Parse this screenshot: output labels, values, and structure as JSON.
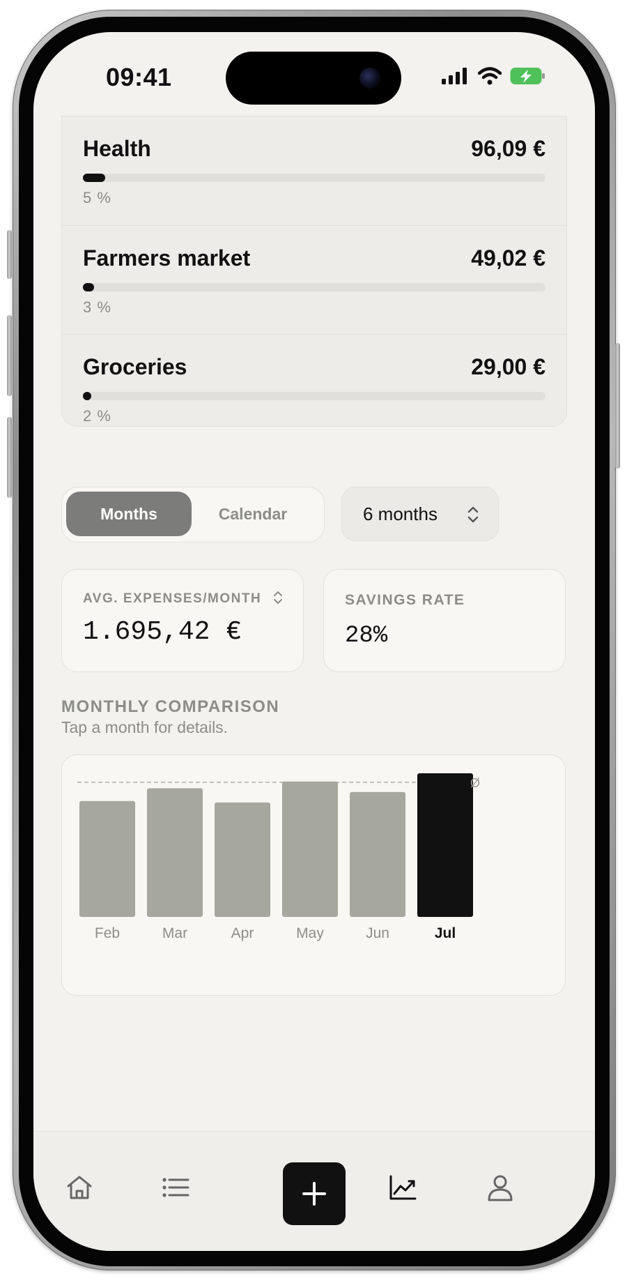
{
  "status": {
    "time": "09:41"
  },
  "categories": [
    {
      "name": "Health",
      "amount": "96,09 €",
      "percent": "5 %",
      "share": 0.05
    },
    {
      "name": "Farmers market",
      "amount": "49,02 €",
      "percent": "3 %",
      "share": 0.03
    },
    {
      "name": "Groceries",
      "amount": "29,00 €",
      "percent": "2 %",
      "share": 0.02
    }
  ],
  "view_toggle": {
    "months_label": "Months",
    "calendar_label": "Calendar",
    "selected": "Months"
  },
  "range": {
    "label": "6 months"
  },
  "stats": {
    "avg_label": "AVG. EXPENSES/MONTH",
    "avg_value": "1.695,42 €",
    "savings_label": "SAVINGS RATE",
    "savings_value": "28%"
  },
  "comparison": {
    "title": "MONTHLY COMPARISON",
    "subtitle": "Tap a month for details."
  },
  "chart_data": {
    "type": "bar",
    "categories": [
      "Feb",
      "Mar",
      "Apr",
      "May",
      "Jun",
      "Jul"
    ],
    "values": [
      1550,
      1720,
      1530,
      1810,
      1670,
      1920
    ],
    "selected": "Jul",
    "reference_line": {
      "label": "Ø",
      "value": 1800,
      "style": "dashed"
    },
    "colors": {
      "bar": "#a6a79e",
      "selected_bar": "#111111",
      "reference": "#b0afa9"
    }
  },
  "tab_bar": {
    "items": [
      "home-icon",
      "list-icon",
      "add-icon",
      "chart-icon",
      "profile-icon"
    ],
    "active": "chart-icon"
  },
  "colors": {
    "background": "#f3f2ee",
    "accent": "#111111",
    "muted": "#8d8d88"
  }
}
